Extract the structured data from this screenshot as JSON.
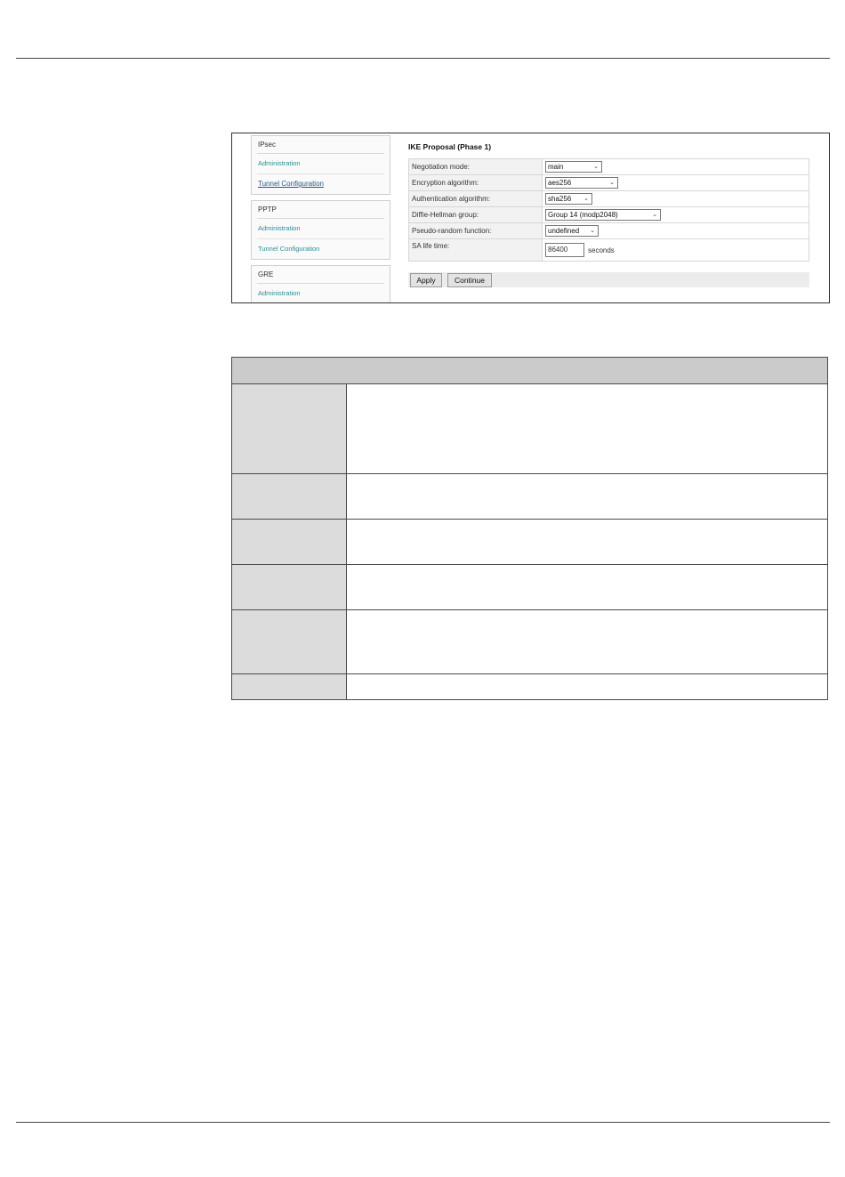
{
  "screenshot": {
    "sidebar": [
      {
        "title": "IPsec",
        "items": [
          {
            "label": "Administration",
            "active": false
          },
          {
            "label": "Tunnel Configuration",
            "active": true
          }
        ]
      },
      {
        "title": "PPTP",
        "items": [
          {
            "label": "Administration",
            "active": false
          },
          {
            "label": "Tunnel Configuration",
            "active": false
          }
        ]
      },
      {
        "title": "GRE",
        "items": [
          {
            "label": "Administration",
            "active": false
          }
        ]
      }
    ],
    "section_title": "IKE Proposal (Phase 1)",
    "fields": {
      "negotiation_mode": {
        "label": "Negotiation mode:",
        "value": "main"
      },
      "encryption_algorithm": {
        "label": "Encryption algorithm:",
        "value": "aes256"
      },
      "authentication_algorithm": {
        "label": "Authentication algorithm:",
        "value": "sha256"
      },
      "dh_group": {
        "label": "Diffie-Hellman group:",
        "value": "Group 14 (modp2048)"
      },
      "prf": {
        "label": "Pseudo-random function:",
        "value": "undefined"
      },
      "sa_lifetime": {
        "label": "SA life time:",
        "value": "86400",
        "unit": "seconds"
      }
    },
    "buttons": {
      "apply": "Apply",
      "continue": "Continue"
    }
  },
  "colors": {
    "link": "#2a8f95",
    "active_link": "#1f5f83",
    "table_header": "#cbcbcb",
    "table_key_cell": "#dcdcdc"
  }
}
